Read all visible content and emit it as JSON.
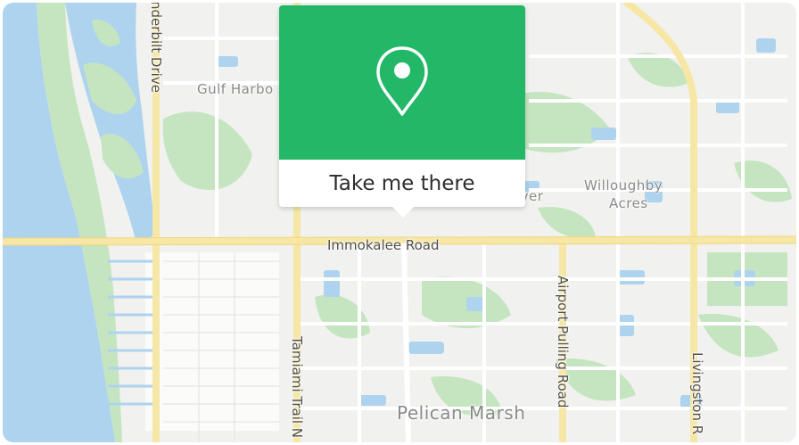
{
  "map": {
    "labels": {
      "vanderbilt_drive": "nderbilt Drive",
      "gulf_harbor": "Gulf Harbo",
      "immokalee_road": "Immokalee Road",
      "tamiami_trail": "Tamiami Trail N",
      "airport_pulling_road": "Airport Pulling Road",
      "livingston_road": "Livingston R",
      "pelican_marsh": "Pelican Marsh",
      "willoughby_acres_line1": "Willoughby",
      "willoughby_acres_line2": "Acres",
      "river_fragment": "iver"
    },
    "colors": {
      "water": "#aed3ef",
      "park": "#c5e5c0",
      "land": "#f1f2ef",
      "major_road": "#f7e7a6",
      "minor_road": "#ffffff"
    }
  },
  "popup": {
    "icon": "map-pin-icon",
    "action_label": "Take me there",
    "header_color": "#22b868"
  }
}
